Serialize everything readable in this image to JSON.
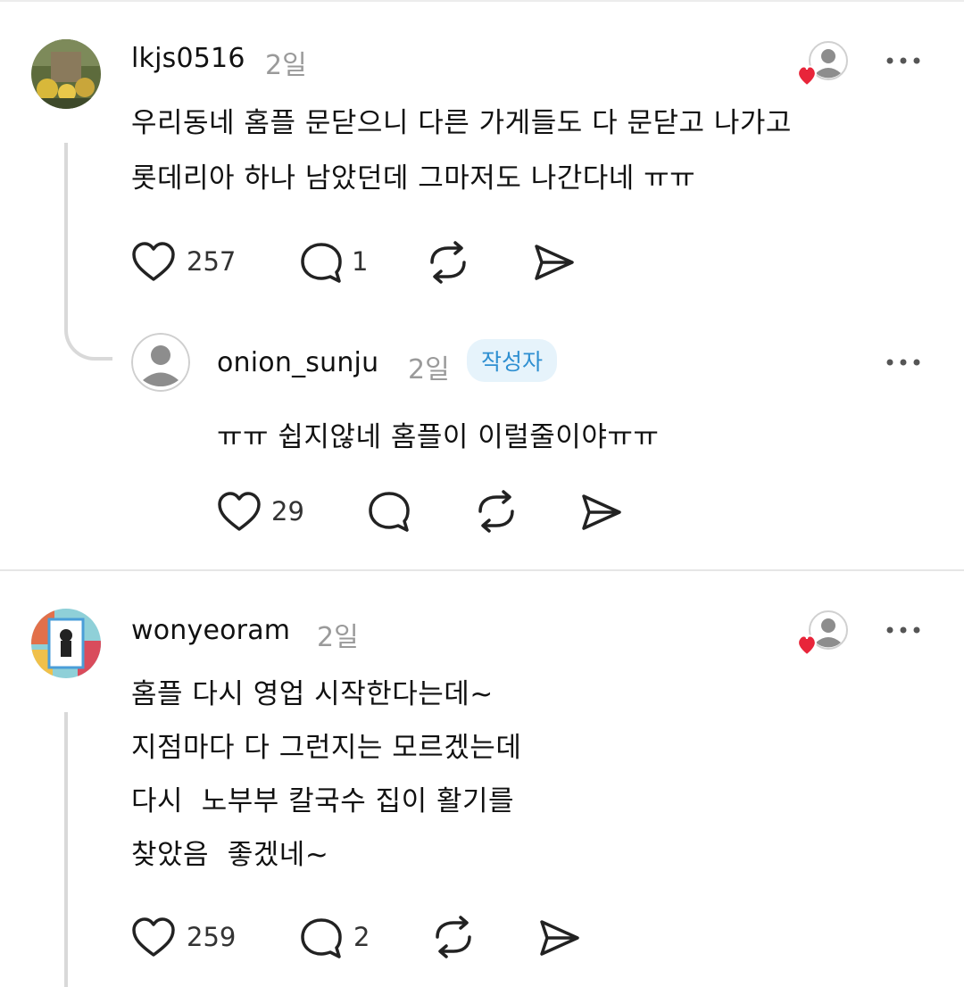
{
  "comments": [
    {
      "username": "lkjs0516",
      "time": "2일",
      "lines": [
        "우리동네 홈플 문닫으니 다른 가게들도 다 문닫고 나가고",
        "롯데리아 하나 남았던데 그마저도 나간다네 ㅠㅠ"
      ],
      "likes": "257",
      "replies": "1"
    },
    {
      "username": "onion_sunju",
      "time": "2일",
      "badge": "작성자",
      "lines": [
        "ㅠㅠ 쉽지않네 홈플이 이럴줄이야ㅠㅠ"
      ],
      "likes": "29"
    },
    {
      "username": "wonyeoram",
      "time": "2일",
      "lines": [
        "홈플 다시 영업 시작한다는데~",
        "지점마다 다 그런지는 모르겠는데",
        "다시  노부부 칼국수 집이 활기를",
        "찾았음  좋겠네~"
      ],
      "likes": "259",
      "replies": "2"
    }
  ],
  "colors": {
    "heart_badge": "#e8253a",
    "author_badge_bg": "#e6f3fb",
    "author_badge_text": "#2e8fd1",
    "muted_text": "#9a9a9a"
  }
}
